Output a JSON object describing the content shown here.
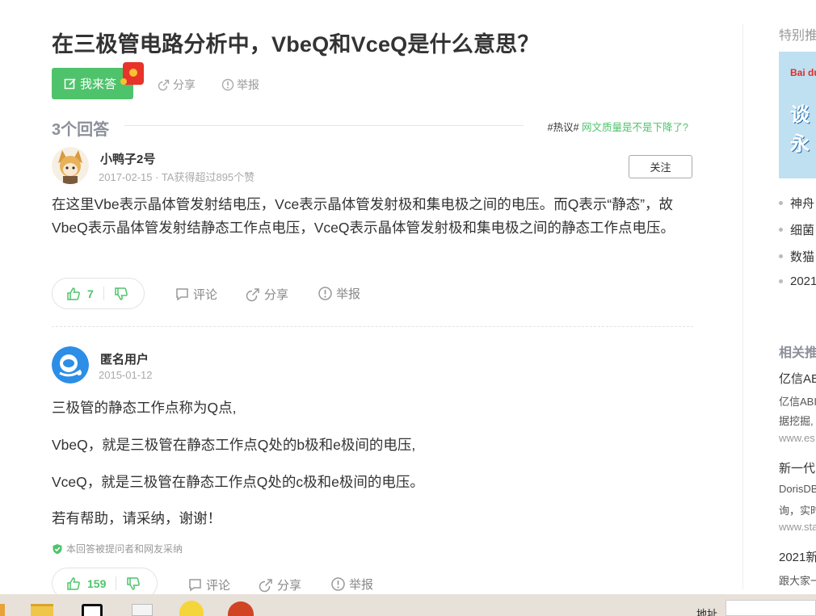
{
  "question": {
    "title": "在三极管电路分析中，VbeQ和VceQ是什么意思？",
    "answer_button": "我来答",
    "share": "分享",
    "report": "举报"
  },
  "answers_header": {
    "count_label": "3个回答",
    "hot_tag": "#热议#",
    "hot_topic": "网文质量是不是下降了?"
  },
  "answer1": {
    "user": "小鸭子2号",
    "meta": "2017-02-15 · TA获得超过895个赞",
    "follow": "关注",
    "text": "在这里Vbe表示晶体管发射结电压，Vce表示晶体管发射极和集电极之间的电压。而Q表示“静态”，故VbeQ表示晶体管发射结静态工作点电压，VceQ表示晶体管发射极和集电极之间的静态工作点电压。",
    "likes": "7",
    "comment": "评论",
    "share": "分享",
    "report": "举报"
  },
  "answer2": {
    "user": "匿名用户",
    "meta": "2015-01-12",
    "paragraphs": [
      "三极管的静态工作点称为Q点,",
      "VbeQ，就是三极管在静态工作点Q处的b极和e极间的电压,",
      "VceQ，就是三极管在静态工作点Q处的c极和e极间的电压。",
      "若有帮助，请采纳，谢谢！"
    ],
    "adopted_note": "本回答被提问者和网友采纳",
    "likes": "159",
    "comment": "评论",
    "share": "分享",
    "report": "举报"
  },
  "sidebar": {
    "promo_head": "特别推",
    "ad_logo": "Bai du",
    "ad_line1": "谈",
    "ad_line2": "永",
    "list": [
      "神舟",
      "细菌",
      "数猫",
      "2021"
    ],
    "related_head": "相关推",
    "related": [
      {
        "title": "亿信AB",
        "desc1": "亿信ABI",
        "desc2": "据挖掘,",
        "url": "www.es"
      },
      {
        "title": "新一代",
        "desc1": "DorisDB",
        "desc2": "询，实时",
        "url": "www.sta"
      },
      {
        "title": "2021新",
        "desc1": "跟大家一",
        "desc2": "",
        "url": ""
      }
    ]
  },
  "taskbar": {
    "address_label": "地址"
  },
  "colors": {
    "green": "#4fc36b",
    "muted": "#999999",
    "text": "#333333"
  }
}
